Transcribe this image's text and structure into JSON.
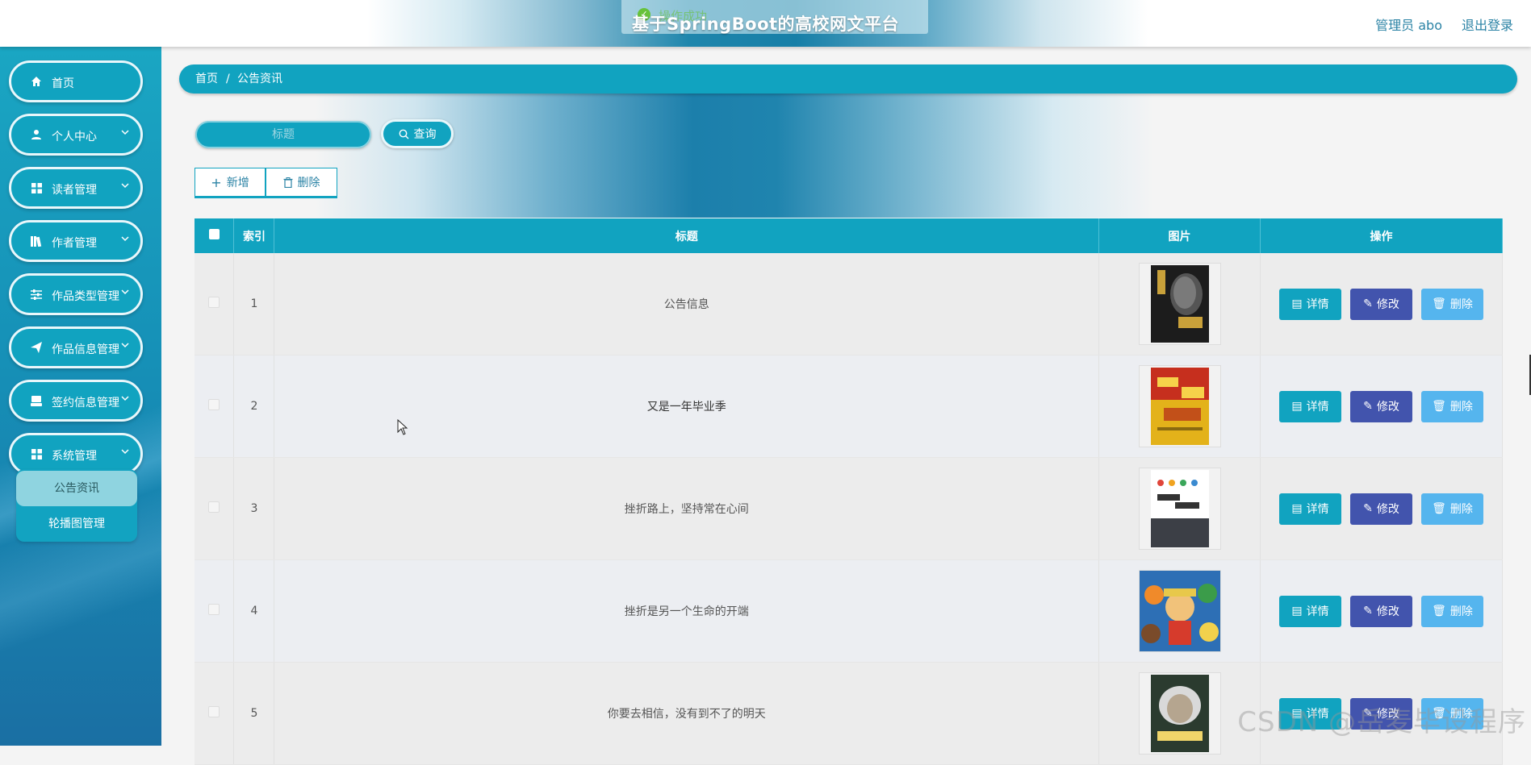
{
  "header": {
    "title": "基于SpringBoot的高校网文平台",
    "toast": "操作成功",
    "user_label": "管理员 abo",
    "logout_label": "退出登录"
  },
  "sidebar": {
    "items": [
      {
        "label": "首页",
        "icon": "home-icon",
        "has_arrow": false
      },
      {
        "label": "个人中心",
        "icon": "user-icon",
        "has_arrow": true
      },
      {
        "label": "读者管理",
        "icon": "grid-icon",
        "has_arrow": true
      },
      {
        "label": "作者管理",
        "icon": "books-icon",
        "has_arrow": true
      },
      {
        "label": "作品类型管理",
        "icon": "sliders-icon",
        "has_arrow": true
      },
      {
        "label": "作品信息管理",
        "icon": "paper-plane-icon",
        "has_arrow": true
      },
      {
        "label": "签约信息管理",
        "icon": "stack-icon",
        "has_arrow": true
      },
      {
        "label": "系统管理",
        "icon": "grid-icon",
        "has_arrow": true
      }
    ],
    "submenu": [
      {
        "label": "公告资讯",
        "active": true
      },
      {
        "label": "轮播图管理",
        "active": false
      }
    ]
  },
  "breadcrumb": {
    "home": "首页",
    "separator": "/",
    "current": "公告资讯"
  },
  "search": {
    "placeholder": "标题",
    "button_label": "查询"
  },
  "actions": {
    "add_label": "新增",
    "delete_label": "删除"
  },
  "table": {
    "headers": {
      "index": "索引",
      "title": "标题",
      "image": "图片",
      "ops": "操作"
    },
    "op_labels": {
      "detail": "详情",
      "edit": "修改",
      "delete": "删除"
    },
    "rows": [
      {
        "index": "1",
        "title": "公告信息",
        "image": "book-cover-dark"
      },
      {
        "index": "2",
        "title": "又是一年毕业季",
        "image": "book-cover-red-yellow"
      },
      {
        "index": "3",
        "title": "挫折路上，坚持常在心间",
        "image": "book-cover-light"
      },
      {
        "index": "4",
        "title": "挫折是另一个生命的开端",
        "image": "anime-cover"
      },
      {
        "index": "5",
        "title": "你要去相信，没有到不了的明天",
        "image": "book-cover-einstein"
      }
    ]
  },
  "watermark": "CSDN @岳麦毕设程序",
  "colors": {
    "primary": "#11a3c0",
    "edit": "#4254ad",
    "delete": "#55b5ee",
    "link": "#2b83a5"
  }
}
